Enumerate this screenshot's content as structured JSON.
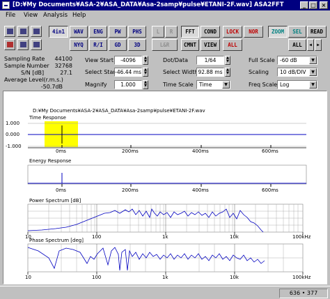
{
  "window": {
    "title": "[D:¥My Documents¥ASA-2¥ASA_DATA¥Asa-2samp¥pulse¥ETANI-2F.wav] ASA2FFT"
  },
  "title_buttons": {
    "minimize": "_",
    "maximize": "□",
    "close": "×"
  },
  "menu": [
    "File",
    "View",
    "Analysis",
    "Help"
  ],
  "toolbar": {
    "row1": [
      "4in1",
      "WAV",
      "ENG",
      "PW",
      "PHS",
      "L",
      "R",
      "FFT",
      "COND",
      "LOCK",
      "NOR",
      "ZOOM",
      "SEL",
      "READ"
    ],
    "row2": [
      "NYQ",
      "R/I",
      "GD",
      "3D",
      "L&R",
      "CMNT",
      "VIEW",
      "ALL",
      "ALL"
    ]
  },
  "info": {
    "sampling_rate_label": "Sampling Rate",
    "sampling_rate": "44100",
    "sample_number_label": "Sample Number",
    "sample_number": "32768",
    "sn_label": "S/N [dB]",
    "sn": "27.1",
    "avg_level_label": "Average Level(r.m.s.)",
    "avg_level": "-50.7dB"
  },
  "controls": {
    "view_start_label": "View Start",
    "view_start": "-4096",
    "select_start_label": "Select Star",
    "select_start": "-46.44 ms",
    "magnify_label": "Magnify",
    "magnify": "1.000",
    "dot_data_label": "Dot/Data",
    "dot_data": "1/64",
    "select_width_label": "Select Width",
    "select_width": "92.88 ms",
    "time_scale_label": "Time Scale",
    "time_scale": "Time",
    "full_scale_label": "Full Scale",
    "full_scale": "-60 dB",
    "scaling_label": "Scaling",
    "scaling": "10 dB/DIV",
    "freq_scale_label": "Freq Scale",
    "freq_scale": "Log"
  },
  "plots": {
    "path": "D:¥My Documents¥ASA-2¥ASA_DATA¥Asa-2samp¥pulse¥ETANI-2F.wav",
    "time_title": "Time Response",
    "time_y": [
      "1.000",
      "0.000",
      "-1.000"
    ],
    "time_x": [
      "0ms",
      "200ms",
      "400ms",
      "600ms"
    ],
    "energy_title": "Energy Response",
    "energy_x": [
      "0ms",
      "200ms",
      "400ms",
      "600ms"
    ],
    "power_title": "Power Spectrum [dB]",
    "phase_title": "Phase Spectrum [deg]",
    "freq_x": [
      "10",
      "100",
      "1k",
      "10k",
      "100kHz"
    ],
    "highlight_color": "#ffff00",
    "trace_color": "#0000c0"
  },
  "status": {
    "coords": "636 • 377"
  }
}
